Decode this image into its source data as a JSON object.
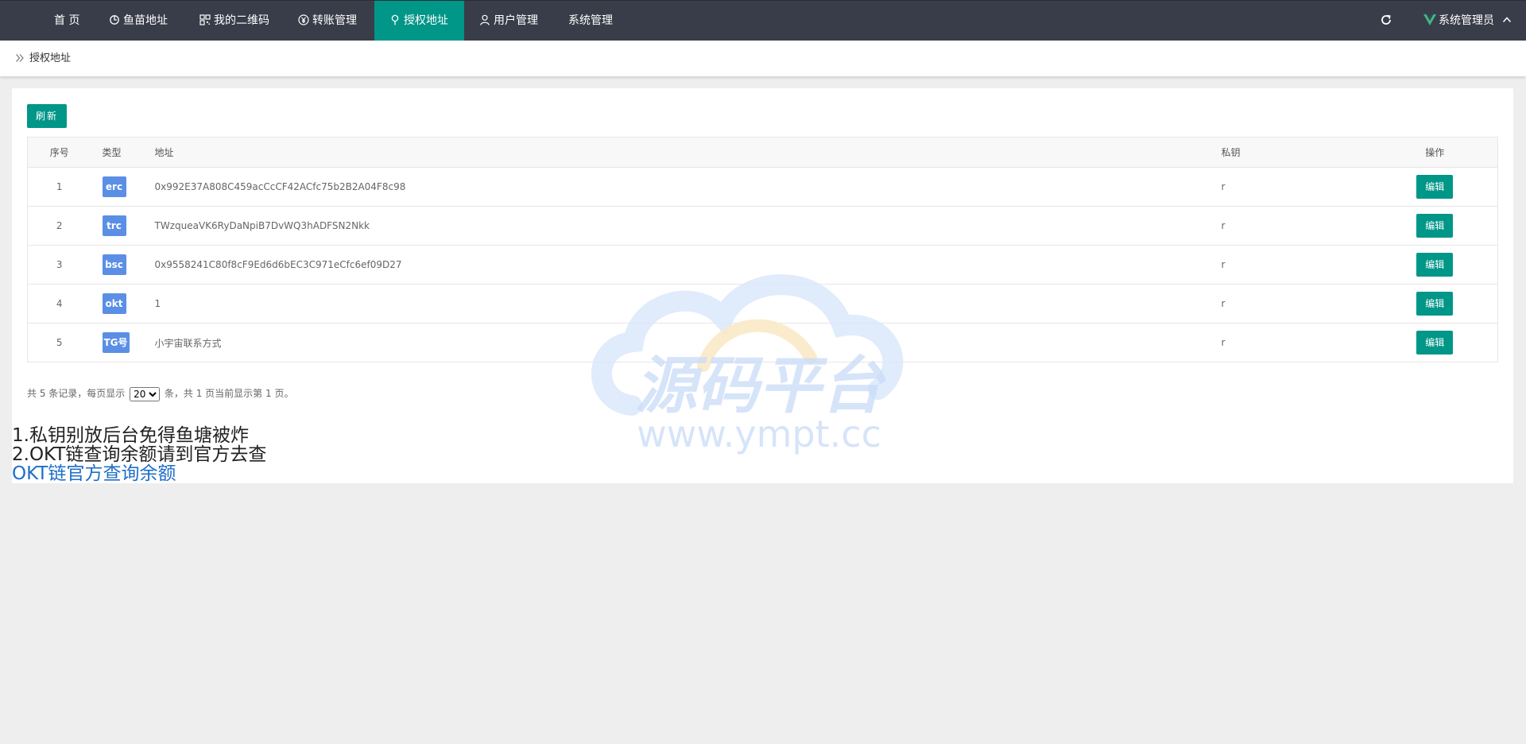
{
  "nav": {
    "items": [
      {
        "label": "首 页",
        "icon": "none"
      },
      {
        "label": "鱼苗地址",
        "icon": "fish-icon"
      },
      {
        "label": "我的二维码",
        "icon": "qrcode-icon"
      },
      {
        "label": "转账管理",
        "icon": "yen-icon"
      },
      {
        "label": "授权地址",
        "icon": "location-pin-icon",
        "active": true
      },
      {
        "label": "用户管理",
        "icon": "user-icon"
      },
      {
        "label": "系统管理",
        "icon": "none"
      }
    ],
    "refresh_icon": "refresh-icon",
    "admin_label": "系统管理员",
    "brand_icon": "vue-logo-icon"
  },
  "breadcrumb": {
    "label": "授权地址"
  },
  "toolbar": {
    "refresh_label": "刷新"
  },
  "table": {
    "headers": [
      "序号",
      "类型",
      "地址",
      "私钥",
      "操作"
    ],
    "rows": [
      {
        "index": "1",
        "type": "erc",
        "address": "0x992E37A808C459acCcCF42ACfc75b2B2A04F8c98",
        "key": "r",
        "action": "编辑"
      },
      {
        "index": "2",
        "type": "trc",
        "address": "TWzqueaVK6RyDaNpiB7DvWQ3hADFSN2Nkk",
        "key": "r",
        "action": "编辑"
      },
      {
        "index": "3",
        "type": "bsc",
        "address": "0x9558241C80f8cF9Ed6d6bEC3C971eCfc6ef09D27",
        "key": "r",
        "action": "编辑"
      },
      {
        "index": "4",
        "type": "okt",
        "address": "1",
        "key": "r",
        "action": "编辑"
      },
      {
        "index": "5",
        "type": "TG号",
        "address": "小宇宙联系方式",
        "key": "r",
        "action": "编辑"
      }
    ]
  },
  "pager": {
    "prefix": "共 5 条记录，每页显示",
    "page_size": "20",
    "suffix": "条，共 1 页当前显示第 1 页。"
  },
  "notes": {
    "line1": "1.私钥别放后台免得鱼塘被炸",
    "line2": "2.OKT链查询余额请到官方去查",
    "link": "OKT链官方查询余额"
  },
  "watermark": {
    "title": "源码平台",
    "url": "www.ympt.cc"
  },
  "colors": {
    "topbar": "#393d49",
    "accent": "#009688",
    "badge": "#5b8fe6",
    "link": "#1e6ec8"
  }
}
